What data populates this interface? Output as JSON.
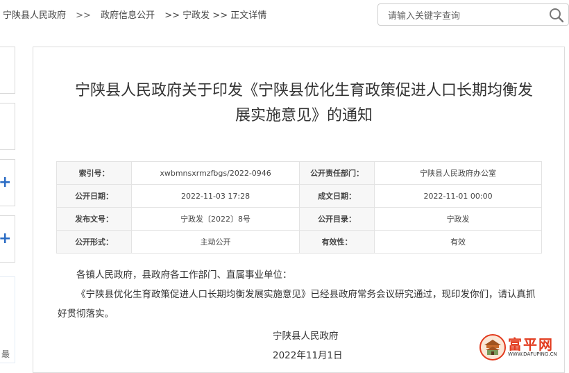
{
  "breadcrumb": {
    "home": "宁陕县人民政府",
    "sep1": ">>",
    "section": "政府信息公开",
    "sep2": ">> 宁政发 >> 正文详情"
  },
  "search": {
    "placeholder": "请输入关键字查询"
  },
  "sidebar": {
    "partial_text": "最"
  },
  "article": {
    "title": "宁陕县人民政府关于印发《宁陕县优化生育政策促进人口长期均衡发展实施意见》的通知",
    "meta": [
      {
        "l1": "索引号：",
        "v1": "xwbmnsxrmzfbgs/2022-0946",
        "l2": "公开责任部门：",
        "v2": "宁陕县人民政府办公室"
      },
      {
        "l1": "公开日期：",
        "v1": "2022-11-03 17:28",
        "l2": "成文日期：",
        "v2": "2022-11-01 00:00"
      },
      {
        "l1": "发布文号：",
        "v1": "宁政发〔2022〕8号",
        "l2": "公开目录：",
        "v2": "宁政发"
      },
      {
        "l1": "公开形式：",
        "v1": "主动公开",
        "l2": "有效性：",
        "v2": "有效"
      }
    ],
    "salutation": "各镇人民政府，县政府各工作部门、直属事业单位：",
    "paragraph": "《宁陕县优化生育政策促进人口长期均衡发展实施意见》已经县政府常务会议研究通过，现印发你们，请认真抓好贯彻落实。",
    "signature": "宁陕县人民政府",
    "date": "2022年11月1日"
  },
  "watermark": {
    "name": "富平网",
    "url": "WWW.DAFUPING.CN"
  }
}
